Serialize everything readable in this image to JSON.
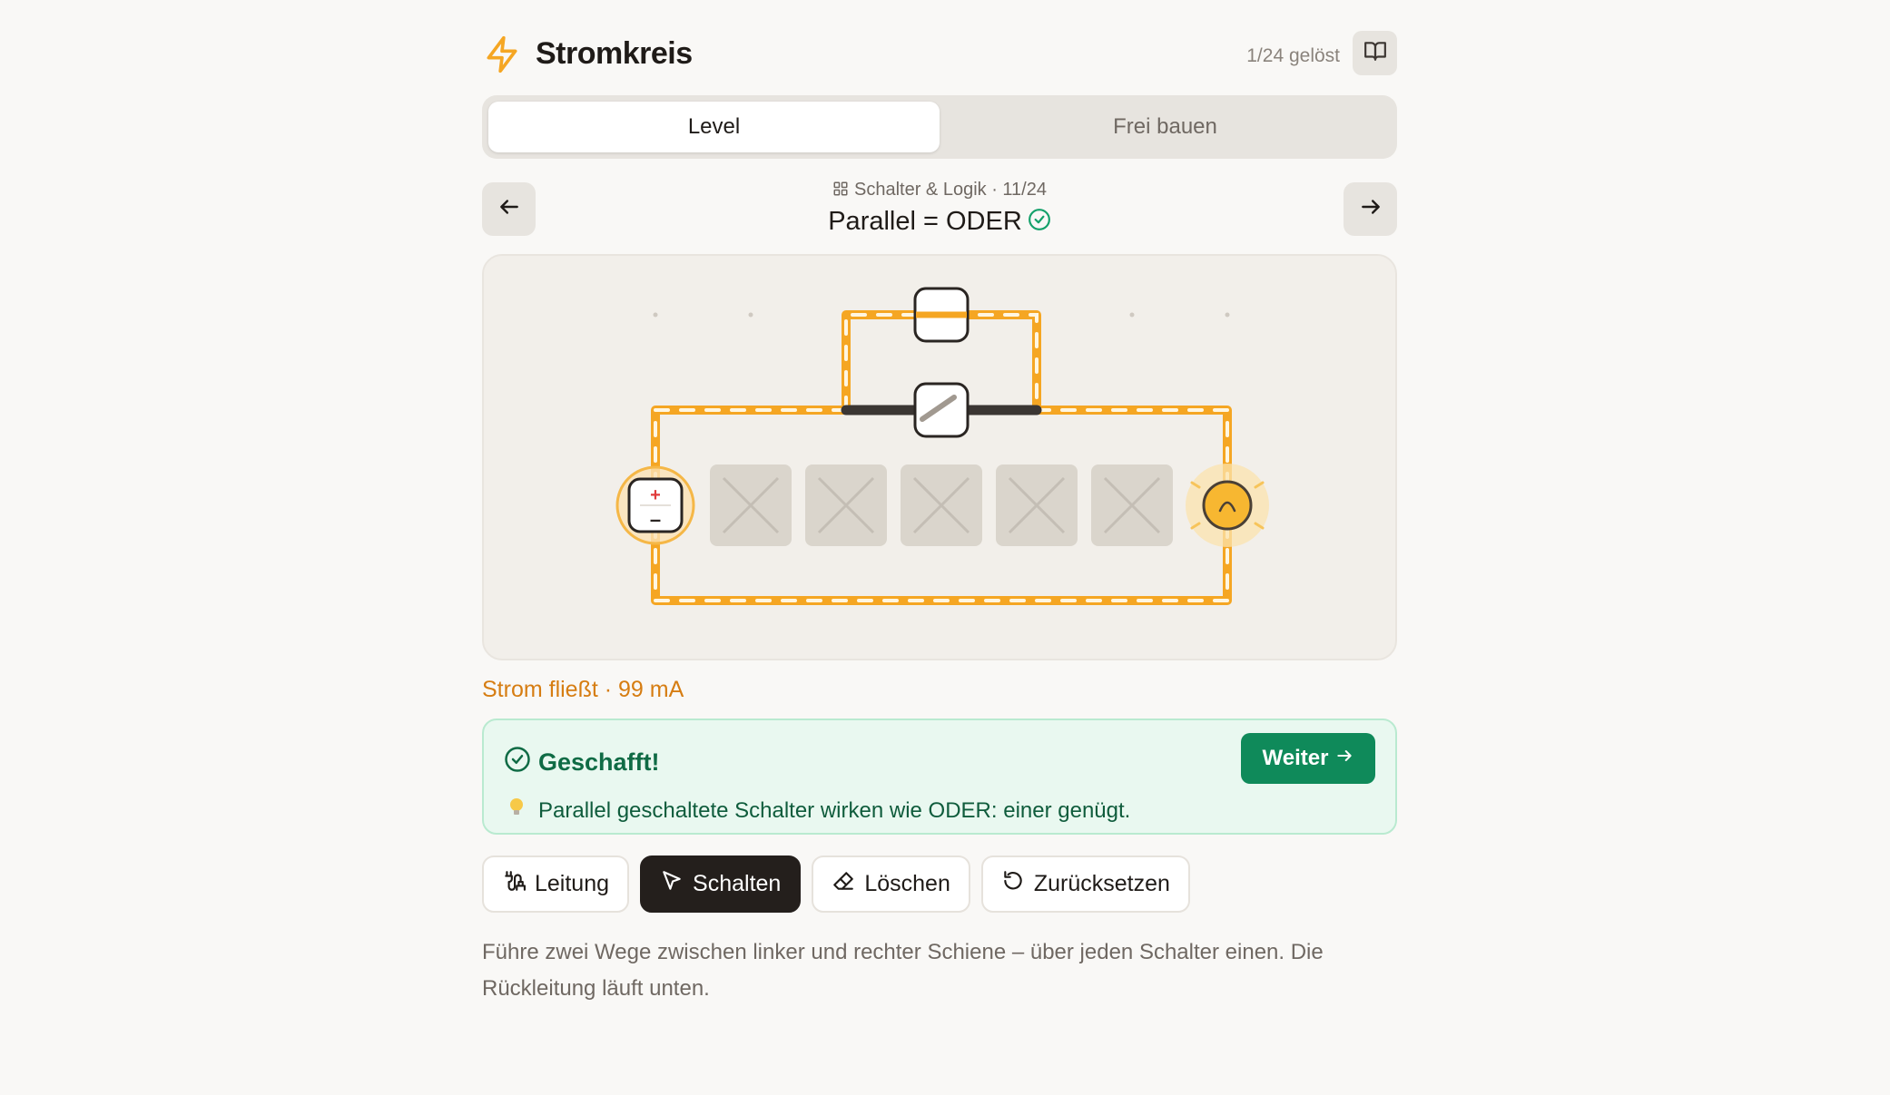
{
  "header": {
    "title": "Stromkreis",
    "progress": "1/24 gelöst",
    "icons": {
      "logo": "lightning-icon",
      "book": "book-icon"
    }
  },
  "tabs": [
    {
      "label": "Level",
      "active": true
    },
    {
      "label": "Frei bauen",
      "active": false
    }
  ],
  "level": {
    "meta": "Schalter & Logik · 11/24",
    "title": "Parallel = ODER",
    "solved": true
  },
  "board": {
    "components": [
      {
        "type": "battery",
        "plus": "+",
        "minus": "–"
      },
      {
        "type": "empty-slot"
      },
      {
        "type": "empty-slot"
      },
      {
        "type": "empty-slot"
      },
      {
        "type": "empty-slot"
      },
      {
        "type": "empty-slot"
      },
      {
        "type": "lamp",
        "lit": true
      }
    ],
    "switches": [
      {
        "position": "upper-branch",
        "state": "closed"
      },
      {
        "position": "lower-branch",
        "state": "open"
      }
    ]
  },
  "status": "Strom fließt · 99 mA",
  "success": {
    "title": "Geschafft!",
    "button": "Weiter",
    "hint": "Parallel geschaltete Schalter wirken wie ODER: einer genügt."
  },
  "tools": [
    {
      "label": "Leitung",
      "icon": "wire-icon",
      "active": false
    },
    {
      "label": "Schalten",
      "icon": "cursor-icon",
      "active": true
    },
    {
      "label": "Löschen",
      "icon": "eraser-icon",
      "active": false
    },
    {
      "label": "Zurücksetzen",
      "icon": "reset-icon",
      "active": false
    }
  ],
  "description": "Führe zwei Wege zwischen linker und rechter Schiene – über jeden Schalter einen. Die Rückleitung läuft unten.",
  "colors": {
    "current": "#f5a623",
    "success": "#0f8a5a",
    "status": "#d67d12"
  }
}
